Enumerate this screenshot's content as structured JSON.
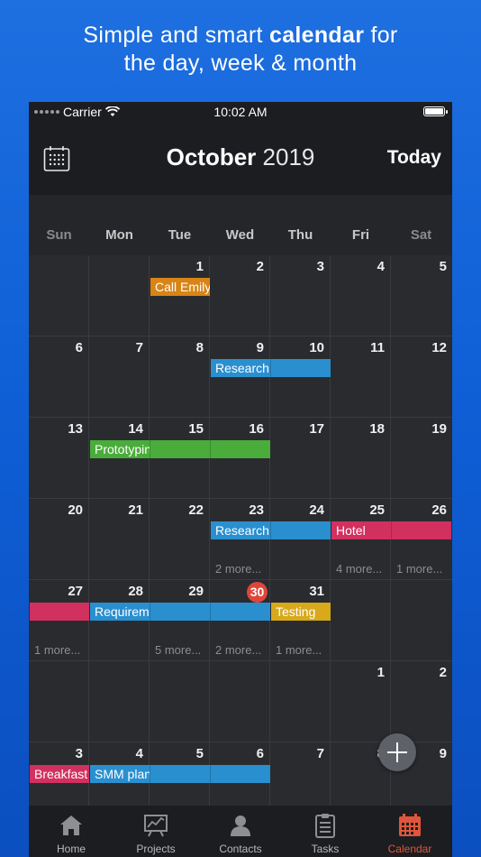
{
  "tagline": {
    "pre": "Simple and smart ",
    "bold": "calendar",
    "post": " for",
    "line2": "the day, week & month"
  },
  "status": {
    "carrier": "Carrier",
    "time": "10:02 AM"
  },
  "header": {
    "month": "October",
    "year": "2019",
    "today_label": "Today",
    "icon": "calendar-grid-icon"
  },
  "weekdays": [
    "Sun",
    "Mon",
    "Tue",
    "Wed",
    "Thu",
    "Fri",
    "Sat"
  ],
  "weeks": [
    [
      "",
      "",
      "1",
      "2",
      "3",
      "4",
      "5"
    ],
    [
      "6",
      "7",
      "8",
      "9",
      "10",
      "11",
      "12"
    ],
    [
      "13",
      "14",
      "15",
      "16",
      "17",
      "18",
      "19"
    ],
    [
      "20",
      "21",
      "22",
      "23",
      "24",
      "25",
      "26"
    ],
    [
      "27",
      "28",
      "29",
      "30",
      "31",
      "",
      ""
    ],
    [
      "",
      "",
      "",
      "",
      "",
      "1",
      "2"
    ],
    [
      "3",
      "4",
      "5",
      "6",
      "7",
      "8",
      "9"
    ]
  ],
  "today": {
    "week": 4,
    "day": 3
  },
  "more_labels": [
    {
      "week": 3,
      "day": 3,
      "text": "2 more..."
    },
    {
      "week": 3,
      "day": 5,
      "text": "4 more..."
    },
    {
      "week": 3,
      "day": 6,
      "text": "1 more..."
    },
    {
      "week": 4,
      "day": 0,
      "text": "1 more..."
    },
    {
      "week": 4,
      "day": 2,
      "text": "5 more..."
    },
    {
      "week": 4,
      "day": 3,
      "text": "2 more..."
    },
    {
      "week": 4,
      "day": 4,
      "text": "1 more..."
    }
  ],
  "events": [
    {
      "title": "Call Emily",
      "week": 0,
      "start": 2,
      "span": 1,
      "color": "#d88416"
    },
    {
      "title": "Research",
      "week": 1,
      "start": 3,
      "span": 2,
      "color": "#2a8fcf"
    },
    {
      "title": "Prototyping",
      "week": 2,
      "start": 1,
      "span": 3,
      "color": "#4aac3a"
    },
    {
      "title": "Research",
      "week": 3,
      "start": 3,
      "span": 2,
      "color": "#2a8fcf"
    },
    {
      "title": "Hotel",
      "week": 3,
      "start": 5,
      "span": 2,
      "color": "#d2305e"
    },
    {
      "title": "",
      "week": 4,
      "start": 0,
      "span": 1,
      "color": "#d2305e"
    },
    {
      "title": "Requirements",
      "week": 4,
      "start": 1,
      "span": 3,
      "color": "#2a8fcf"
    },
    {
      "title": "Testing",
      "week": 4,
      "start": 4,
      "span": 1,
      "color": "#d8a91a"
    },
    {
      "title": "Breakfast",
      "week": 6,
      "start": 0,
      "span": 1,
      "color": "#d2305e"
    },
    {
      "title": "SMM plan",
      "week": 6,
      "start": 1,
      "span": 3,
      "color": "#2a8fcf"
    }
  ],
  "tabs": [
    {
      "label": "Home",
      "icon": "home-icon",
      "active": false
    },
    {
      "label": "Projects",
      "icon": "projects-chart-icon",
      "active": false
    },
    {
      "label": "Contacts",
      "icon": "contacts-icon",
      "active": false
    },
    {
      "label": "Tasks",
      "icon": "tasks-clipboard-icon",
      "active": false
    },
    {
      "label": "Calendar",
      "icon": "calendar-icon",
      "active": true
    }
  ],
  "colors": {
    "accent": "#e0563a",
    "today": "#e0453a"
  }
}
